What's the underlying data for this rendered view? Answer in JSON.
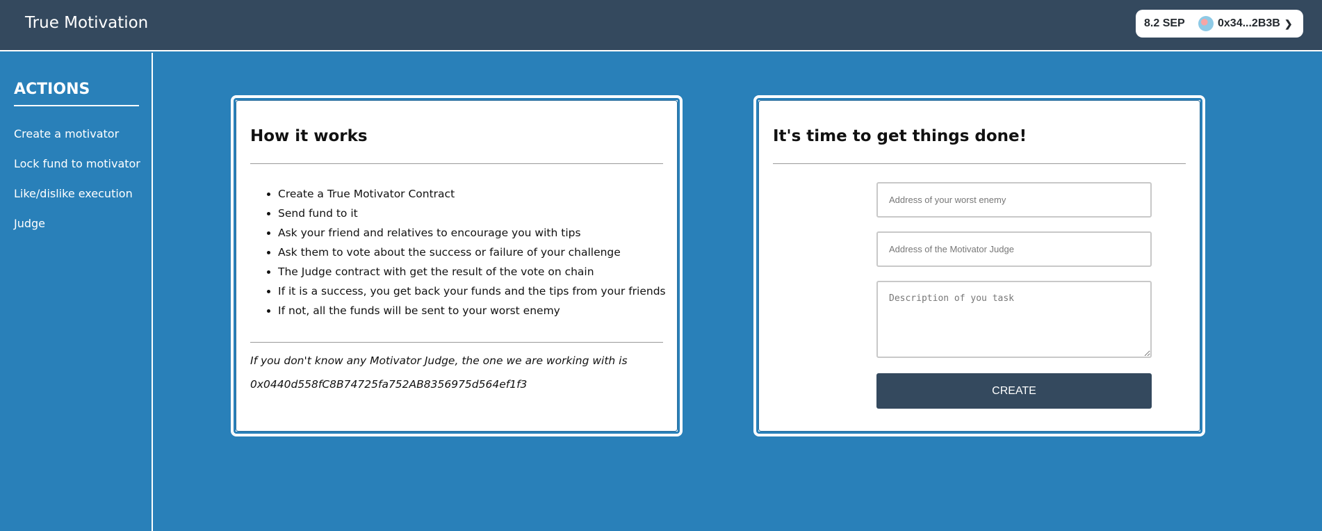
{
  "header": {
    "title": "True Motivation",
    "wallet": {
      "balance": "8.2 SEP",
      "account": "0x34...2B3B"
    }
  },
  "sidebar": {
    "title": "ACTIONS",
    "items": [
      {
        "label": "Create a motivator"
      },
      {
        "label": "Lock fund to motivator"
      },
      {
        "label": "Like/dislike execution"
      },
      {
        "label": "Judge"
      }
    ]
  },
  "how_it_works": {
    "title": "How it works",
    "steps": [
      "Create a True Motivator Contract",
      "Send fund to it",
      "Ask your friend and relatives to encourage you with tips",
      "Ask them to vote about the success or failure of your challenge",
      "The Judge contract with get the result of the vote on chain",
      "If it is a success, you get back your funds and the tips from your friends",
      "If not, all the funds will be sent to your worst enemy"
    ],
    "note": "If you don't know any Motivator Judge, the one we are working with is",
    "judge_address": "0x0440d558fC8B74725fa752AB8356975d564ef1f3"
  },
  "create_form": {
    "title": "It's time to get things done!",
    "enemy_placeholder": "Address of your worst enemy",
    "enemy_value": "",
    "judge_placeholder": "Address of the Motivator Judge",
    "judge_value": "",
    "description_placeholder": "Description of you task",
    "description_value": "",
    "submit_label": "CREATE"
  },
  "colors": {
    "header_bg": "#34495e",
    "page_bg": "#2980b9",
    "button_bg": "#34495e"
  }
}
